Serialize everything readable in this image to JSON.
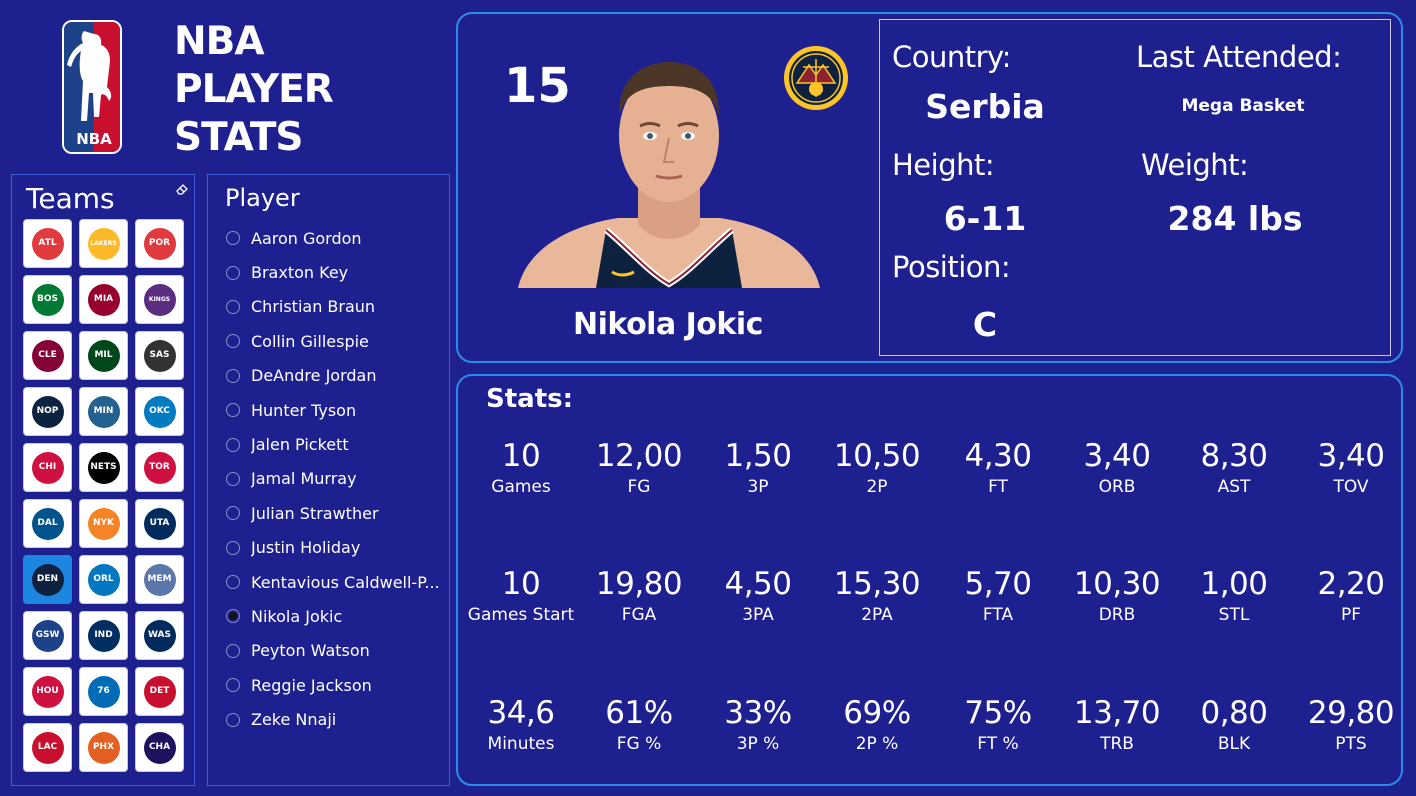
{
  "app": {
    "title": "NBA\nPLAYER\nSTATS",
    "logo_text": "NBA"
  },
  "teams": {
    "title": "Teams",
    "items": [
      {
        "icon": "hawks-logo-icon",
        "abbr": "ATL",
        "color": "#e03a3e",
        "selected": false
      },
      {
        "icon": "lakers-logo-icon",
        "abbr": "LAKERS",
        "color": "#fdb927",
        "selected": false
      },
      {
        "icon": "trail-blazers-logo-icon",
        "abbr": "POR",
        "color": "#e03a3e",
        "selected": false
      },
      {
        "icon": "celtics-logo-icon",
        "abbr": "BOS",
        "color": "#007a33",
        "selected": false
      },
      {
        "icon": "heat-logo-icon",
        "abbr": "MIA",
        "color": "#98002e",
        "selected": false
      },
      {
        "icon": "kings-logo-icon",
        "abbr": "KINGS",
        "color": "#5a2d81",
        "selected": false
      },
      {
        "icon": "cavaliers-logo-icon",
        "abbr": "CLE",
        "color": "#860038",
        "selected": false
      },
      {
        "icon": "bucks-logo-icon",
        "abbr": "MIL",
        "color": "#00471b",
        "selected": false
      },
      {
        "icon": "spurs-logo-icon",
        "abbr": "SAS",
        "color": "#333333",
        "selected": false
      },
      {
        "icon": "pelicans-logo-icon",
        "abbr": "NOP",
        "color": "#0c2340",
        "selected": false
      },
      {
        "icon": "timberwolves-logo-icon",
        "abbr": "MIN",
        "color": "#236192",
        "selected": false
      },
      {
        "icon": "thunder-logo-icon",
        "abbr": "OKC",
        "color": "#007ac1",
        "selected": false
      },
      {
        "icon": "bulls-logo-icon",
        "abbr": "CHI",
        "color": "#ce1141",
        "selected": false
      },
      {
        "icon": "nets-logo-icon",
        "abbr": "NETS",
        "color": "#000000",
        "selected": false
      },
      {
        "icon": "raptors-logo-icon",
        "abbr": "TOR",
        "color": "#ce1141",
        "selected": false
      },
      {
        "icon": "mavericks-logo-icon",
        "abbr": "DAL",
        "color": "#00538c",
        "selected": false
      },
      {
        "icon": "knicks-logo-icon",
        "abbr": "NYK",
        "color": "#f58426",
        "selected": false
      },
      {
        "icon": "jazz-logo-icon",
        "abbr": "UTA",
        "color": "#002b5c",
        "selected": false
      },
      {
        "icon": "nuggets-logo-icon",
        "abbr": "DEN",
        "color": "#0e2240",
        "selected": true
      },
      {
        "icon": "magic-logo-icon",
        "abbr": "ORL",
        "color": "#0077c0",
        "selected": false
      },
      {
        "icon": "grizzlies-logo-icon",
        "abbr": "MEM",
        "color": "#5d76a9",
        "selected": false
      },
      {
        "icon": "warriors-logo-icon",
        "abbr": "GSW",
        "color": "#1d428a",
        "selected": false
      },
      {
        "icon": "pacers-logo-icon",
        "abbr": "IND",
        "color": "#002d62",
        "selected": false
      },
      {
        "icon": "wizards-logo-icon",
        "abbr": "WAS",
        "color": "#002b5c",
        "selected": false
      },
      {
        "icon": "rockets-logo-icon",
        "abbr": "HOU",
        "color": "#ce1141",
        "selected": false
      },
      {
        "icon": "76ers-logo-icon",
        "abbr": "76",
        "color": "#006bb6",
        "selected": false
      },
      {
        "icon": "pistons-logo-icon",
        "abbr": "DET",
        "color": "#c8102e",
        "selected": false
      },
      {
        "icon": "clippers-logo-icon",
        "abbr": "LAC",
        "color": "#c8102e",
        "selected": false
      },
      {
        "icon": "suns-logo-icon",
        "abbr": "PHX",
        "color": "#e56020",
        "selected": false
      },
      {
        "icon": "hornets-logo-icon",
        "abbr": "CHA",
        "color": "#1d1160",
        "selected": false
      }
    ]
  },
  "players": {
    "title": "Player",
    "items": [
      {
        "name": "Aaron Gordon",
        "selected": false
      },
      {
        "name": "Braxton Key",
        "selected": false
      },
      {
        "name": "Christian Braun",
        "selected": false
      },
      {
        "name": "Collin Gillespie",
        "selected": false
      },
      {
        "name": "DeAndre Jordan",
        "selected": false
      },
      {
        "name": "Hunter Tyson",
        "selected": false
      },
      {
        "name": "Jalen Pickett",
        "selected": false
      },
      {
        "name": "Jamal Murray",
        "selected": false
      },
      {
        "name": "Julian Strawther",
        "selected": false
      },
      {
        "name": "Justin Holiday",
        "selected": false
      },
      {
        "name": "Kentavious Caldwell-P...",
        "selected": false
      },
      {
        "name": "Nikola Jokic",
        "selected": true
      },
      {
        "name": "Peyton Watson",
        "selected": false
      },
      {
        "name": "Reggie Jackson",
        "selected": false
      },
      {
        "name": "Zeke Nnaji",
        "selected": false
      }
    ]
  },
  "profile": {
    "jersey": "15",
    "name": "Nikola Jokic",
    "country_label": "Country:",
    "country": "Serbia",
    "last_attended_label": "Last Attended:",
    "last_attended": "Mega Basket",
    "height_label": "Height:",
    "height": "6-11",
    "weight_label": "Weight:",
    "weight": "284 lbs",
    "position_label": "Position:",
    "position": "C"
  },
  "stats": {
    "title": "Stats:",
    "rows": [
      [
        {
          "value": "10",
          "label": "Games"
        },
        {
          "value": "12,00",
          "label": "FG"
        },
        {
          "value": "1,50",
          "label": "3P"
        },
        {
          "value": "10,50",
          "label": "2P"
        },
        {
          "value": "4,30",
          "label": "FT"
        },
        {
          "value": "3,40",
          "label": "ORB"
        },
        {
          "value": "8,30",
          "label": "AST"
        },
        {
          "value": "3,40",
          "label": "TOV"
        }
      ],
      [
        {
          "value": "10",
          "label": "Games Start"
        },
        {
          "value": "19,80",
          "label": "FGA"
        },
        {
          "value": "4,50",
          "label": "3PA"
        },
        {
          "value": "15,30",
          "label": "2PA"
        },
        {
          "value": "5,70",
          "label": "FTA"
        },
        {
          "value": "10,30",
          "label": "DRB"
        },
        {
          "value": "1,00",
          "label": "STL"
        },
        {
          "value": "2,20",
          "label": "PF"
        }
      ],
      [
        {
          "value": "34,6",
          "label": "Minutes"
        },
        {
          "value": "61%",
          "label": "FG %"
        },
        {
          "value": "33%",
          "label": "3P %"
        },
        {
          "value": "69%",
          "label": "2P %"
        },
        {
          "value": "75%",
          "label": "FT %"
        },
        {
          "value": "13,70",
          "label": "TRB"
        },
        {
          "value": "0,80",
          "label": "BLK"
        },
        {
          "value": "29,80",
          "label": "PTS"
        }
      ]
    ]
  },
  "colors": {
    "background": "#1e2090",
    "accent_border": "#2a8ce6",
    "selected_tile": "#1d86e0"
  }
}
